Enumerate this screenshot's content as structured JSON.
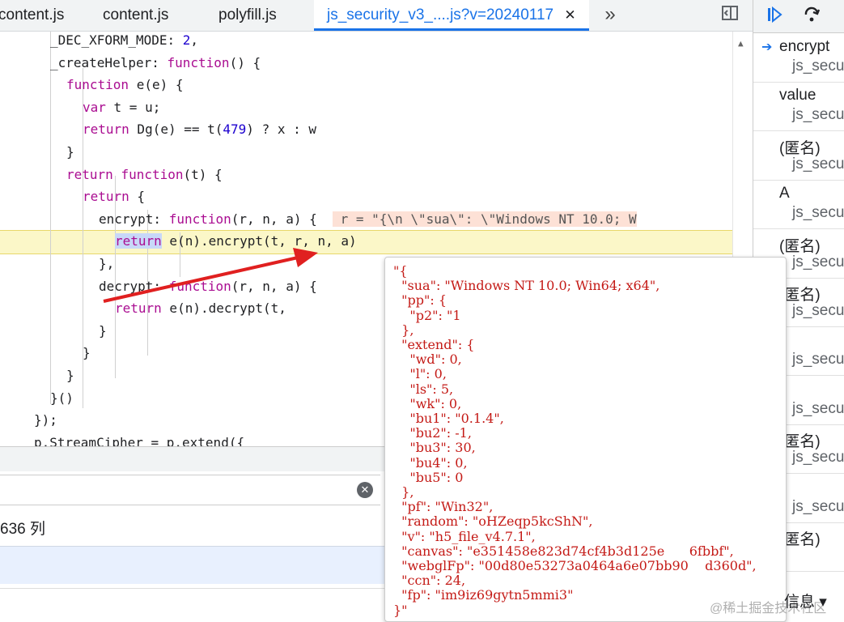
{
  "tabs": [
    {
      "label": "content.js",
      "active": false
    },
    {
      "label": "content.js",
      "active": false
    },
    {
      "label": "polyfill.js",
      "active": false
    },
    {
      "label": "js_security_v3_....js?v=20240117",
      "active": true
    }
  ],
  "tab_close": "✕",
  "tab_more": "»",
  "code": [
    {
      "indent": 4,
      "html": "_DEC_XFORM_MODE: <span class='num'>2</span>,"
    },
    {
      "indent": 4,
      "html": "_createHelper: <span class='kw'>function</span>() {"
    },
    {
      "indent": 6,
      "html": "<span class='kw'>function</span> e(e) {"
    },
    {
      "indent": 8,
      "html": "<span class='kw'>var</span> t = u;"
    },
    {
      "indent": 8,
      "html": "<span class='kw'>return</span> Dg(e) == t(<span class='num'>479</span>) ? x : w"
    },
    {
      "indent": 6,
      "html": "}"
    },
    {
      "indent": 6,
      "html": "<span class='kw'>return</span> <span class='kw'>function</span>(t) {"
    },
    {
      "indent": 8,
      "html": "<span class='kw'>return</span> {"
    },
    {
      "indent": 10,
      "html": "encrypt: <span class='kw'>function</span>(r, n, a) {  <span class='inline-val'> r = \"{\\n \\\"sua\\\": \\\"Windows NT 10.0; W</span>"
    },
    {
      "indent": 12,
      "html": "<span class='kw sel'>return</span> e(n).encrypt(t, r, n, a)"
    },
    {
      "indent": 10,
      "html": "},"
    },
    {
      "indent": 10,
      "html": "decrypt: <span class='kw'>function</span>(r, n, a) {"
    },
    {
      "indent": 12,
      "html": "<span class='kw'>return</span> e(n).decrypt(t,"
    },
    {
      "indent": 10,
      "html": "}"
    },
    {
      "indent": 8,
      "html": "}"
    },
    {
      "indent": 6,
      "html": "}"
    },
    {
      "indent": 4,
      "html": "}()"
    },
    {
      "indent": 2,
      "html": "});"
    },
    {
      "indent": 2,
      "html": "p.StreamCipher = p.extend({"
    }
  ],
  "status": {
    "position": "636 列"
  },
  "console_level": "信息 ▾",
  "callstack": [
    {
      "fn": "encrypt",
      "loc": "js_secu",
      "current": true
    },
    {
      "fn": "value",
      "loc": "js_secu",
      "current": false
    },
    {
      "fn": "(匿名)",
      "loc": "js_secu",
      "current": false
    },
    {
      "fn": "A",
      "loc": "js_secu",
      "current": false
    },
    {
      "fn": "(匿名)",
      "loc": "js_secu",
      "current": false
    },
    {
      "fn": "(匿名)",
      "loc": "js_secu",
      "current": false
    },
    {
      "fn": "",
      "loc": "js_secu",
      "current": false
    },
    {
      "fn": "",
      "loc": "js_secu",
      "current": false
    },
    {
      "fn": "(匿名)",
      "loc": "js_secu",
      "current": false
    },
    {
      "fn": "",
      "loc": "js_secu",
      "current": false
    },
    {
      "fn": "(匿名)",
      "loc": "",
      "current": false
    }
  ],
  "popup_lines": [
    "\"{",
    "  \"sua\": \"Windows NT 10.0; Win64; x64\",",
    "  \"pp\": {",
    "    \"p2\": \"1",
    "  },",
    "  \"extend\": {",
    "    \"wd\": 0,",
    "    \"l\": 0,",
    "    \"ls\": 5,",
    "    \"wk\": 0,",
    "    \"bu1\": \"0.1.4\",",
    "    \"bu2\": -1,",
    "    \"bu3\": 30,",
    "    \"bu4\": 0,",
    "    \"bu5\": 0",
    "  },",
    "  \"pf\": \"Win32\",",
    "  \"random\": \"oHZeqp5kcShN\",",
    "  \"v\": \"h5_file_v4.7.1\",",
    "  \"canvas\": \"e351458e823d74cf4b3d125e      6fbbf\",",
    "  \"webglFp\": \"00d80e53273a0464a6e07bb90    d360d\",",
    "  \"ccn\": 24,",
    "  \"fp\": \"im9iz69gytn5mmi3\"",
    "}\""
  ],
  "watermark": "@稀土掘金技术社区",
  "icons": {
    "toggle_sidebar": "sidebar-toggle-icon",
    "resume": "resume-icon",
    "step_over": "step-over-icon",
    "clear": "clear-icon"
  }
}
